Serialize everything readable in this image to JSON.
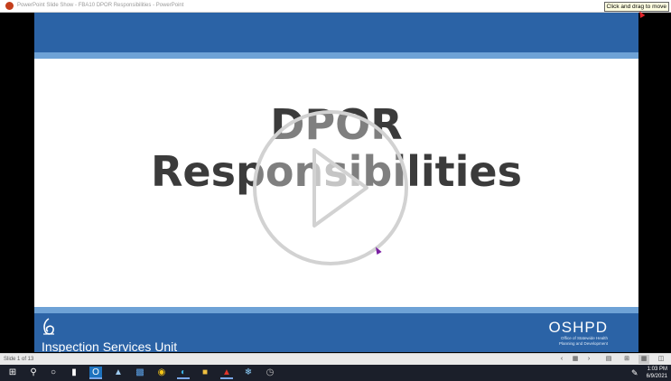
{
  "window": {
    "title": "PowerPoint Slide Show  -  FBA10 DPOR Responsibilities - PowerPoint",
    "drag_tooltip": "Click and drag to move"
  },
  "slide": {
    "title_line1": "DPOR",
    "title_line2": "Responsibilities",
    "unit_label": "Inspection Services Unit",
    "org_name": "OSHPD",
    "org_sub_1": "Office of Statewide Health",
    "org_sub_2": "Planning and Development",
    "colors": {
      "band": "#2b63a6",
      "stripe": "#6ea2d6"
    }
  },
  "player": {
    "play_icon": "play-icon"
  },
  "statusbar": {
    "slide_info": "Slide 1 of 13",
    "controls": [
      "previous-icon",
      "slide-menu-icon",
      "next-icon",
      "normal-view-icon",
      "slide-sorter-icon",
      "reading-view-icon",
      "presenter-icon"
    ]
  },
  "taskbar": {
    "time": "1:03 PM",
    "date": "6/9/2021",
    "icons": [
      "windows-start-icon",
      "search-icon",
      "cortana-icon",
      "task-view-icon",
      "outlook-icon",
      "app-icon",
      "file-icon",
      "chrome-icon",
      "edge-icon",
      "file-explorer-icon",
      "acrobat-icon",
      "settings-icon",
      "clock-app-icon"
    ]
  }
}
